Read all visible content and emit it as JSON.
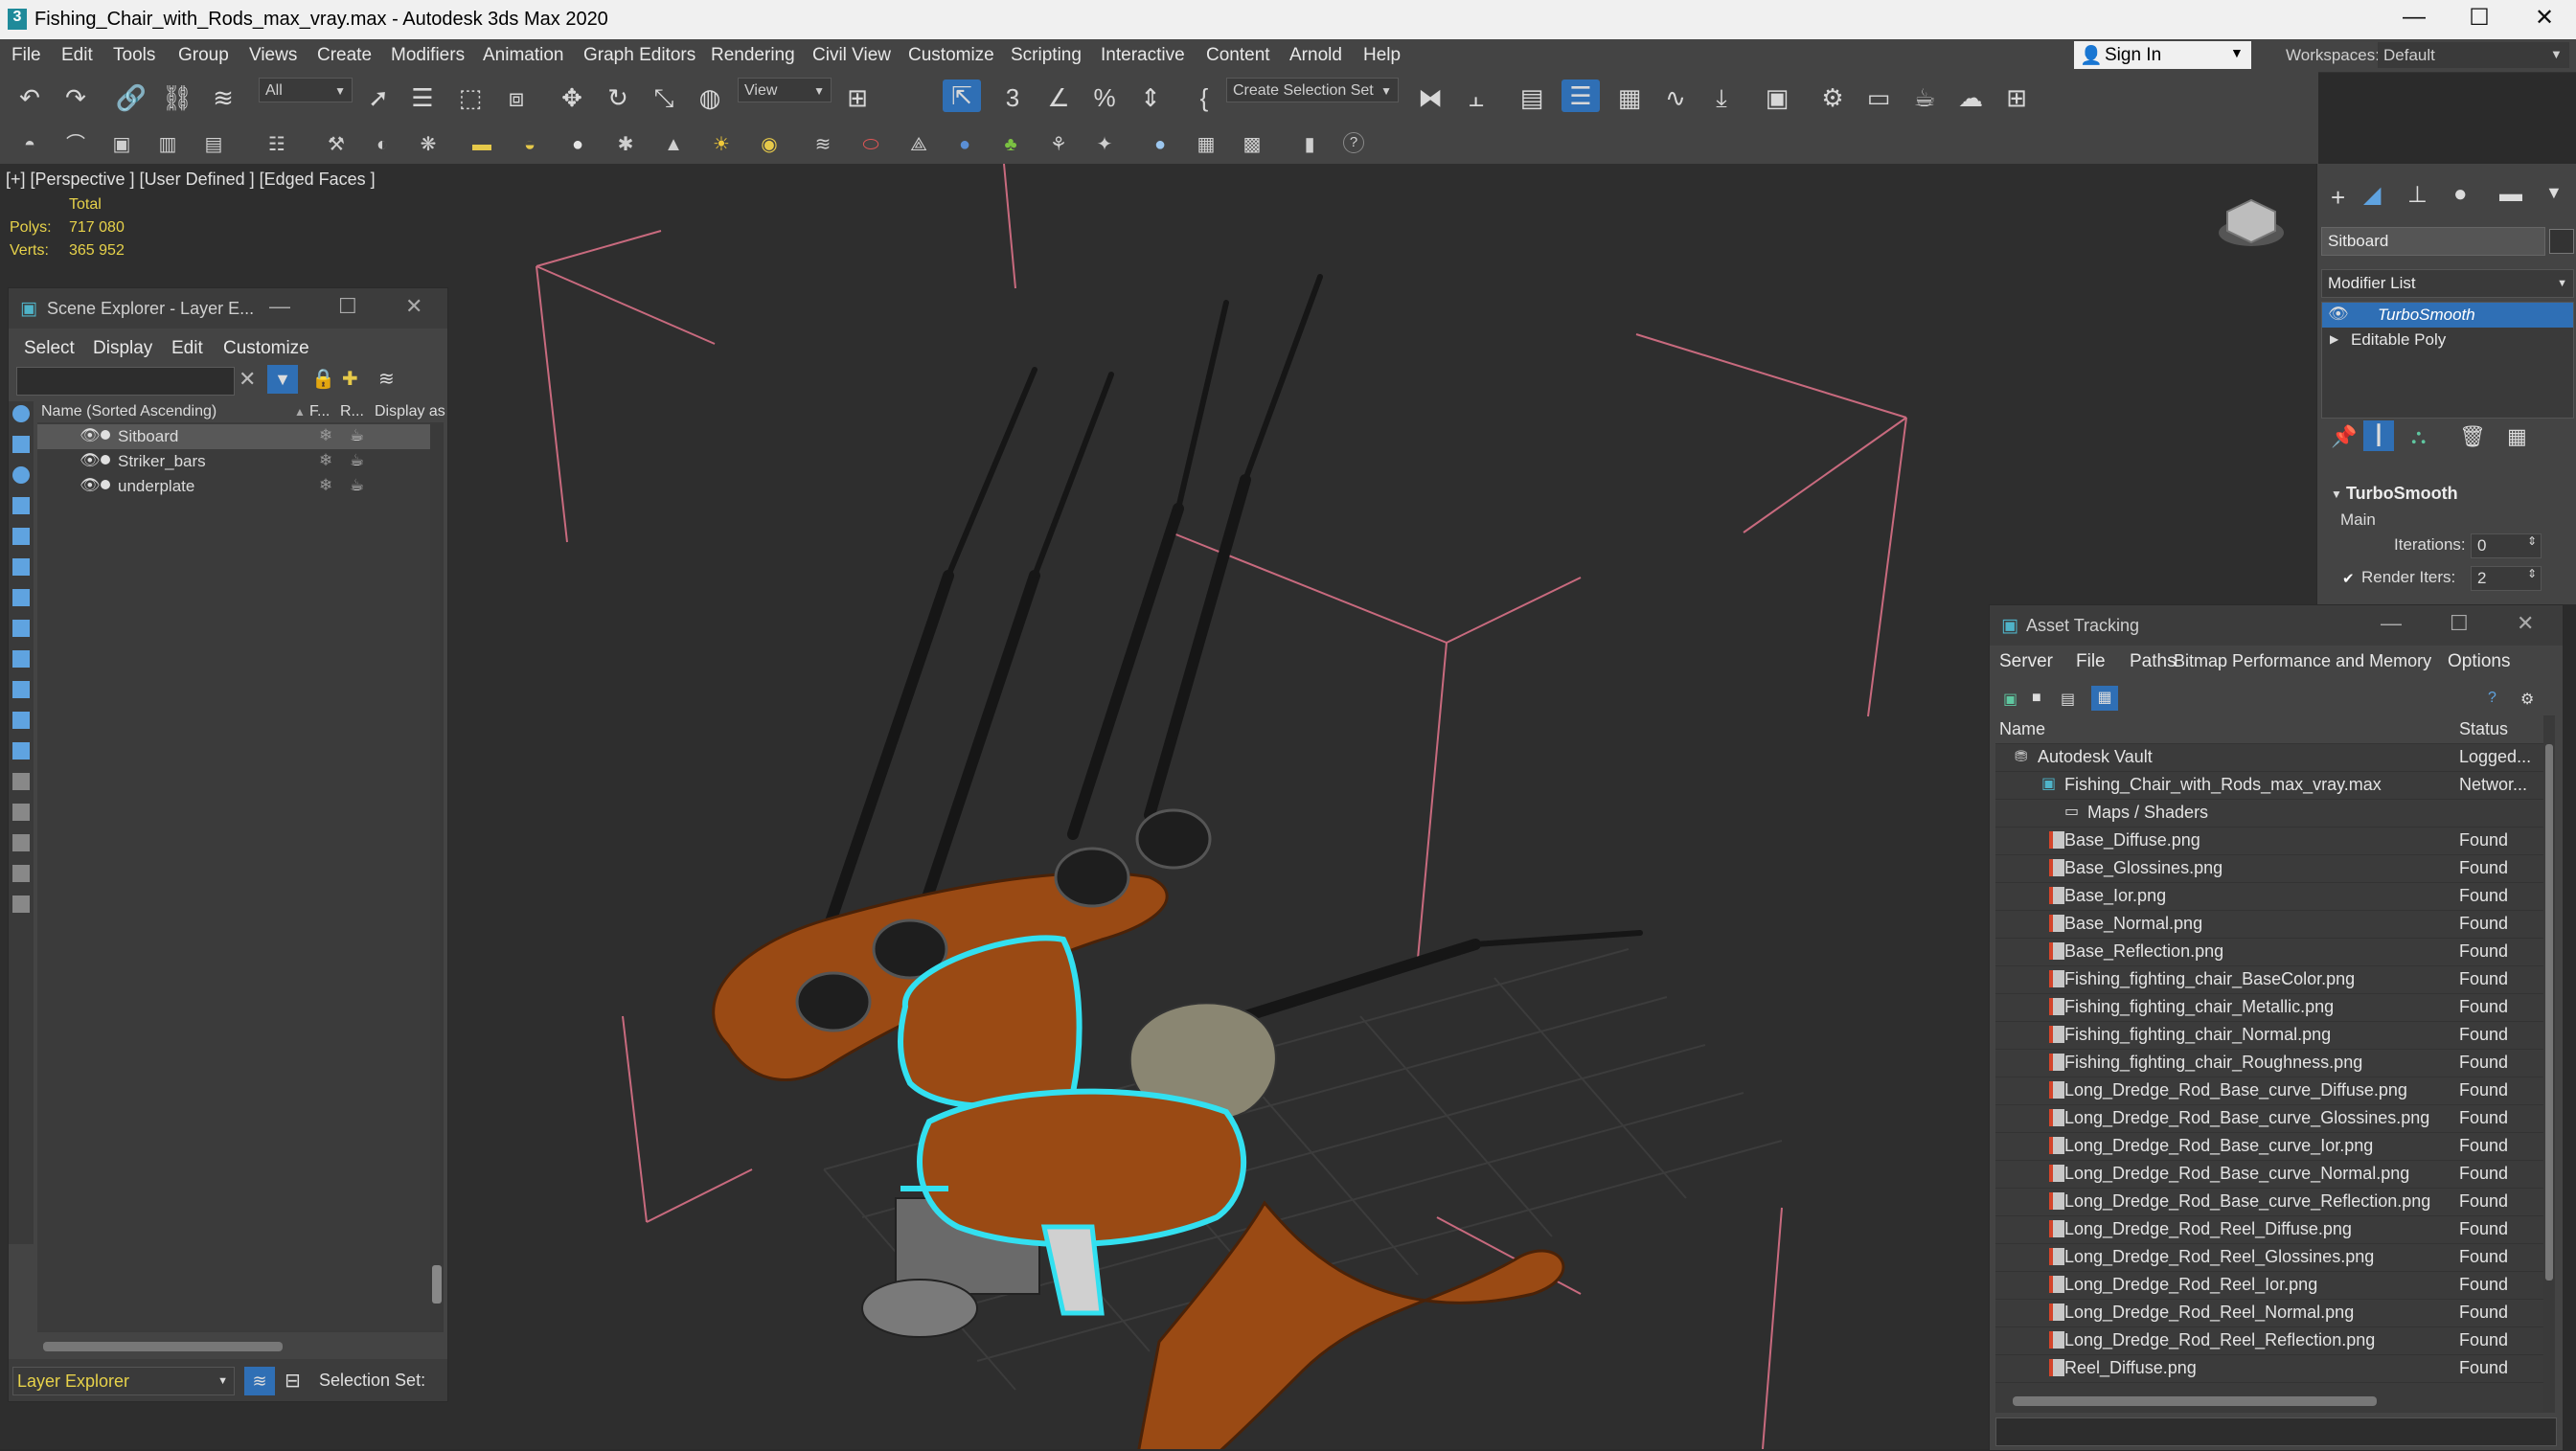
{
  "window": {
    "title": "Fishing_Chair_with_Rods_max_vray.max - Autodesk 3ds Max 2020",
    "minimize": "—",
    "maximize": "☐",
    "close": "✕"
  },
  "menubar": {
    "items": [
      "File",
      "Edit",
      "Tools",
      "Group",
      "Views",
      "Create",
      "Modifiers",
      "Animation",
      "Graph Editors",
      "Rendering",
      "Civil View",
      "Customize",
      "Scripting",
      "Interactive",
      "Content",
      "Arnold",
      "Help"
    ],
    "signin": "Sign In",
    "workspaces_label": "Workspaces:",
    "workspaces_value": "Default"
  },
  "toolbar": {
    "selection_filter": "All",
    "reference_coord": "View",
    "selection_set": "Create Selection Set"
  },
  "viewport": {
    "label": "[+] [Perspective ] [User Defined ] [Edged Faces ]",
    "stats_header": "Total",
    "polys_label": "Polys:",
    "polys_value": "717 080",
    "verts_label": "Verts:",
    "verts_value": "365 952"
  },
  "scene_explorer": {
    "title": "Scene Explorer - Layer E...",
    "menu": [
      "Select",
      "Display",
      "Edit",
      "Customize"
    ],
    "columns": {
      "name": "Name (Sorted Ascending)",
      "frozen": "F...",
      "render": "R...",
      "display": "Display as"
    },
    "rows": [
      "Sitboard",
      "Striker_bars",
      "underplate"
    ],
    "footer_layer": "Layer Explorer",
    "footer_selset": "Selection Set:"
  },
  "command_panel": {
    "object_name": "Sitboard",
    "modifier_list": "Modifier List",
    "stack": [
      "TurboSmooth",
      "Editable Poly"
    ],
    "rollout_title": "TurboSmooth",
    "section_main": "Main",
    "iterations_label": "Iterations:",
    "iterations_value": "0",
    "render_iters_label": "Render Iters:",
    "render_iters_value": "2"
  },
  "asset_tracking": {
    "title": "Asset Tracking",
    "menu": [
      "Server",
      "File",
      "Paths",
      "Bitmap Performance and Memory",
      "Options"
    ],
    "col_name": "Name",
    "col_status": "Status",
    "vault": {
      "name": "Autodesk Vault",
      "status": "Logged..."
    },
    "file": {
      "name": "Fishing_Chair_with_Rods_max_vray.max",
      "status": "Networ..."
    },
    "maps_folder": "Maps / Shaders",
    "found_label": "Found",
    "assets": [
      "Base_Diffuse.png",
      "Base_Glossines.png",
      "Base_Ior.png",
      "Base_Normal.png",
      "Base_Reflection.png",
      "Fishing_fighting_chair_BaseColor.png",
      "Fishing_fighting_chair_Metallic.png",
      "Fishing_fighting_chair_Normal.png",
      "Fishing_fighting_chair_Roughness.png",
      "Long_Dredge_Rod_Base_curve_Diffuse.png",
      "Long_Dredge_Rod_Base_curve_Glossines.png",
      "Long_Dredge_Rod_Base_curve_Ior.png",
      "Long_Dredge_Rod_Base_curve_Normal.png",
      "Long_Dredge_Rod_Base_curve_Reflection.png",
      "Long_Dredge_Rod_Reel_Diffuse.png",
      "Long_Dredge_Rod_Reel_Glossines.png",
      "Long_Dredge_Rod_Reel_Ior.png",
      "Long_Dredge_Rod_Reel_Normal.png",
      "Long_Dredge_Rod_Reel_Reflection.png",
      "Reel_Diffuse.png"
    ]
  },
  "colors": {
    "accent_blue": "#2f6fb5",
    "stat_yellow": "#e7d24a",
    "selection_cyan": "#33e0f0",
    "wood": "#9a4a14",
    "gizmo_pink": "#c86a7e"
  }
}
